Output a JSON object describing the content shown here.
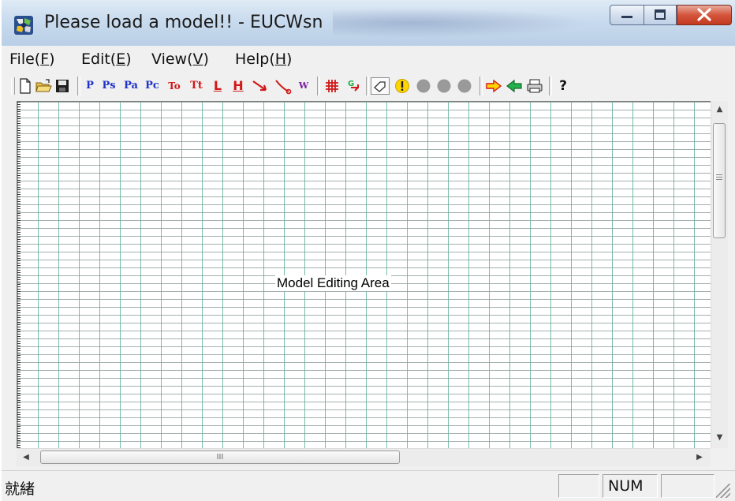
{
  "window": {
    "title": "Please load a model!! - EUCWsn",
    "controls": {
      "minimize": "minimize-icon",
      "maximize": "maximize-icon",
      "close": "close-icon"
    }
  },
  "menubar": {
    "items": [
      {
        "label": "File",
        "mnemonic": "F"
      },
      {
        "label": "Edit",
        "mnemonic": "E"
      },
      {
        "label": "View",
        "mnemonic": "V"
      },
      {
        "label": "Help",
        "mnemonic": "H"
      }
    ]
  },
  "toolbar": {
    "file_buttons": [
      "new-document-icon",
      "open-folder-icon",
      "save-disk-icon"
    ],
    "text_tools": [
      {
        "label": "P",
        "color": "#1f33c8"
      },
      {
        "label": "Ps",
        "color": "#1f33c8"
      },
      {
        "label": "Pa",
        "color": "#1f33c8"
      },
      {
        "label": "Pc",
        "color": "#1f33c8"
      },
      {
        "label": "To",
        "color": "#d01818"
      },
      {
        "label": "Tt",
        "color": "#d01818"
      },
      {
        "label": "L",
        "color": "#d01818"
      },
      {
        "label": "H",
        "color": "#d01818"
      },
      {
        "label": "W",
        "color": "#7a1fa0"
      }
    ],
    "glyph_labels": {
      "link": "↘",
      "curved_link": "↘",
      "grid": "#",
      "go": "G",
      "reset": "!",
      "help": "?"
    },
    "icons": [
      "arrow-link-icon",
      "curved-arrow-icon",
      "grid-toggle-icon",
      "go-icon",
      "pointer-icon",
      "warning-icon",
      "run-light-1-icon",
      "run-light-2-icon",
      "run-light-3-icon",
      "forward-arrow-icon",
      "back-arrow-icon",
      "print-icon",
      "help-icon"
    ],
    "colors": {
      "red": "#d01818",
      "blue": "#1f33c8",
      "purple": "#7a1fa0",
      "yellow": "#ffd400",
      "green": "#22b14c",
      "grey": "#9a9a9a"
    }
  },
  "editor": {
    "area_label": "Model Editing Area",
    "grid_color": "#5faf9b"
  },
  "scrollbars": {
    "up_arrow": "▲",
    "down_arrow": "▼",
    "left_arrow": "◀",
    "right_arrow": "▶",
    "thumb_grip": "III"
  },
  "statusbar": {
    "message": "就緒",
    "num_indicator": "NUM"
  }
}
